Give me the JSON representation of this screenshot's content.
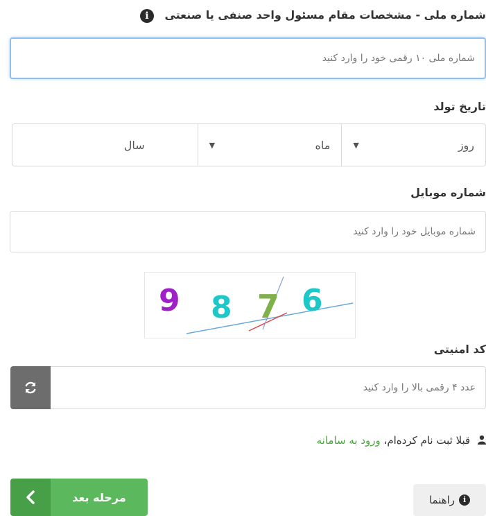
{
  "national_id": {
    "label": "شماره ملی - مشخصات مقام مسئول واحد صنفی یا صنعتی",
    "info_icon": "i",
    "placeholder": "شماره ملی ۱۰ رقمی خود را وارد کنید"
  },
  "birth_date": {
    "label": "تاریخ تولد",
    "day": "روز",
    "month": "ماه",
    "year": "سال"
  },
  "mobile": {
    "label": "شماره موبایل",
    "placeholder": "شماره موبایل خود را وارد کنید"
  },
  "captcha": {
    "digits": [
      "9",
      "8",
      "7",
      "6"
    ],
    "digit_colors": [
      "#a020c8",
      "#1ec8c8",
      "#7fb04a",
      "#1ec8c8"
    ]
  },
  "security_code": {
    "label": "کد امنیتی",
    "placeholder": "عدد ۴ رقمی بالا را وارد کنید",
    "refresh_icon": "refresh-icon"
  },
  "login": {
    "text": "قبلا ثبت نام کرده‌ام،",
    "link": "ورود به سامانه",
    "icon": "user-icon"
  },
  "buttons": {
    "next": "مرحله بعد",
    "help": "راهنما"
  },
  "colors": {
    "primary_green": "#5cb85c",
    "link_green": "#4aa641",
    "refresh_gray": "#6d6d6d"
  }
}
